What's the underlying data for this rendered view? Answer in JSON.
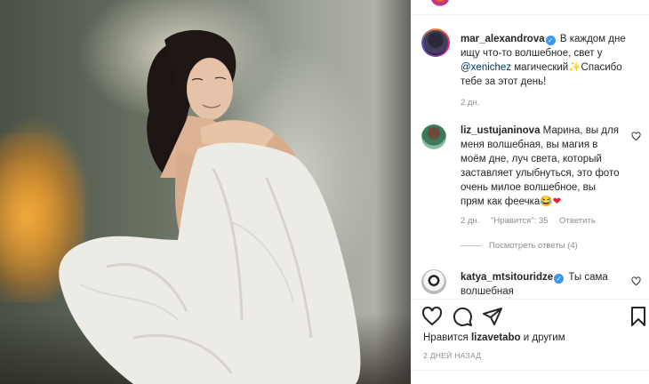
{
  "post": {
    "author": "mar_alexandrova",
    "caption_text": "В каждом дне ищу что-то волшебное, свет у",
    "caption_mention": "@xenichez",
    "caption_text2": "магический",
    "caption_emoji": "✨",
    "caption_text3": "Спасибо тебе за этот день!",
    "caption_time": "2 дн."
  },
  "comments": [
    {
      "username": "liz_ustujaninova",
      "text": "Марина, вы для меня волшебная, вы магия в моём дне, луч света, который заставляет улыбнуться, это фото очень милое волшебное, вы прям как феечка",
      "emoji_laugh": "😂",
      "emoji_heart": "❤",
      "time": "2 дн.",
      "likes": "\"Нравится\": 35",
      "reply": "Ответить",
      "view_replies": "Посмотреть ответы (4)"
    },
    {
      "username": "katya_mtsitouridze",
      "text": "Ты сама волшебная"
    }
  ],
  "likes": {
    "prefix": "Нравится",
    "user": "lizavetabo",
    "suffix": "и другим"
  },
  "date": "2 дней назад",
  "icons": {
    "like": "heart-icon",
    "comment": "comment-icon",
    "share": "paper-plane-icon",
    "save": "bookmark-icon",
    "verified": "verified-badge-icon"
  },
  "colors": {
    "verified": "#3897f0",
    "link": "#00376b",
    "meta": "#8e8e8e",
    "text": "#262626"
  }
}
